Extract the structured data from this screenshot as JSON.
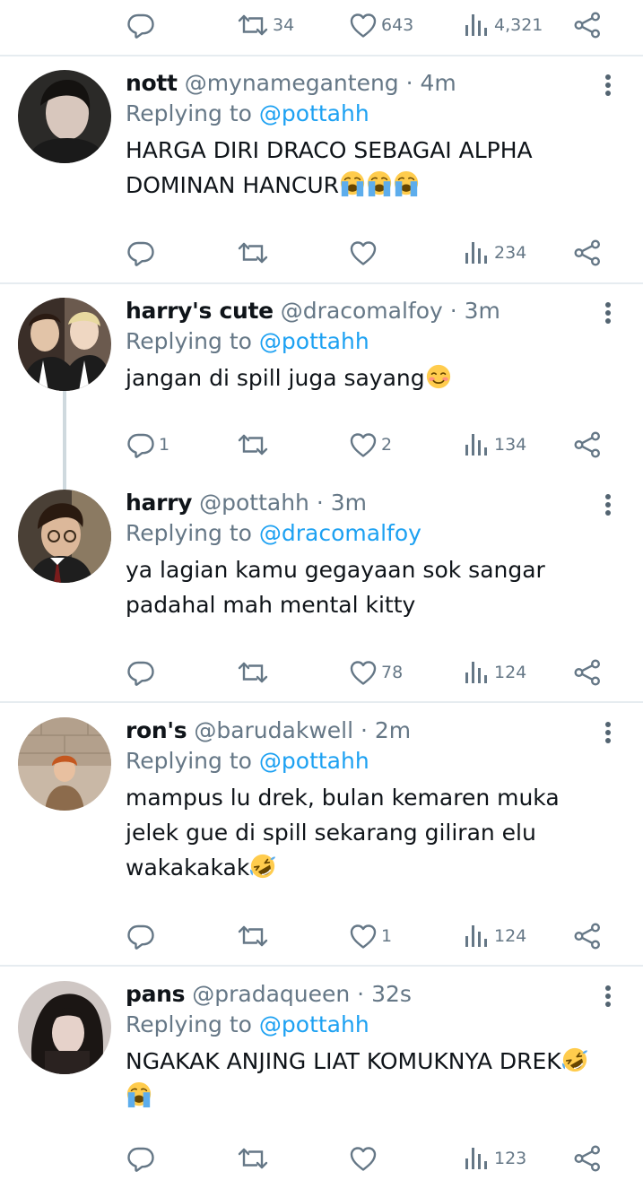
{
  "top_actions": {
    "reply": "",
    "retweet": "34",
    "like": "643",
    "views": "4,321"
  },
  "tweets": [
    {
      "name": "nott",
      "handle": "@mynameganteng · 4m",
      "replying_label": "Replying to",
      "replying_to": "@pottahh",
      "lines": [
        "HARGA DIRI DRACO SEBAGAI ALPHA",
        "DOMINAN HANCUR"
      ],
      "emojis": [
        "loudly-crying-face",
        "loudly-crying-face",
        "loudly-crying-face"
      ],
      "reply_count": "",
      "retweet_count": "",
      "like_count": "",
      "view_count": "234"
    },
    {
      "name": "harry's cute",
      "handle": "@dracomalfoy · 3m",
      "replying_label": "Replying to",
      "replying_to": "@pottahh",
      "lines": [
        "jangan di spill juga sayang"
      ],
      "emojis": [
        "smiling-face"
      ],
      "reply_count": "1",
      "retweet_count": "",
      "like_count": "2",
      "view_count": "134"
    },
    {
      "name": "harry",
      "handle": "@pottahh · 3m",
      "replying_label": "Replying to",
      "replying_to": "@dracomalfoy",
      "lines": [
        "ya lagian kamu gegayaan sok sangar",
        "padahal mah mental kitty"
      ],
      "emojis": [],
      "reply_count": "",
      "retweet_count": "",
      "like_count": "78",
      "view_count": "124"
    },
    {
      "name": "ron's",
      "handle": "@barudakwell · 2m",
      "replying_label": "Replying to",
      "replying_to": "@pottahh",
      "lines": [
        "mampus lu drek, bulan kemaren muka",
        "jelek gue di spill sekarang giliran elu",
        "wakakakak"
      ],
      "emojis": [
        "rolling-on-floor-laughing"
      ],
      "reply_count": "",
      "retweet_count": "",
      "like_count": "1",
      "view_count": "124"
    },
    {
      "name": "pans",
      "handle": "@pradaqueen · 32s",
      "replying_label": "Replying to",
      "replying_to": "@pottahh",
      "lines": [
        "NGAKAK ANJING LIAT KOMUKNYA DREK"
      ],
      "emojis": [
        "rolling-on-floor-laughing",
        "loudly-crying-face"
      ],
      "reply_count": "",
      "retweet_count": "",
      "like_count": "",
      "view_count": "123"
    }
  ],
  "colors": {
    "link": "#1da1f2",
    "muted": "#657786",
    "text": "#0f1419",
    "divider": "#e6ecf0"
  }
}
